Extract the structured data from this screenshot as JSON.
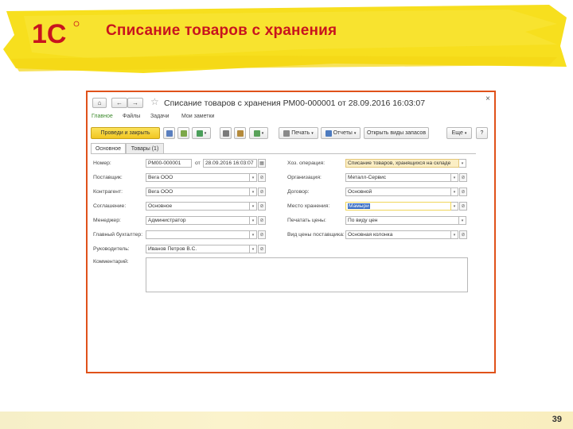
{
  "slide": {
    "title": "Списание товаров с хранения",
    "number": "39",
    "logo_text": "1С"
  },
  "window": {
    "title": "Списание товаров с хранения РМ00-000001 от 28.09.2016 16:03:07",
    "close_glyph": "×",
    "nav": {
      "home": "⌂",
      "back": "←",
      "forward": "→",
      "star": "☆"
    },
    "sections": [
      "Главное",
      "Файлы",
      "Задачи",
      "Мои заметки"
    ],
    "toolbar": {
      "post_and_close": "Проведи и закрыть",
      "print": "Печать",
      "reports": "Отчеты",
      "open_stock": "Открыть виды запасов",
      "more": "Еще",
      "help": "?"
    },
    "tabs": [
      "Основное",
      "Товары (1)"
    ]
  },
  "form": {
    "left": {
      "number_label": "Номер:",
      "number_value": "РМ00-000001",
      "date_sep": "от",
      "date_value": "28.09.2016 16:03:07",
      "supplier_label": "Поставщик:",
      "supplier_value": "Вега ООО",
      "counterparty_label": "Контрагент:",
      "counterparty_value": "Вега ООО",
      "agreement_label": "Соглашение:",
      "agreement_value": "Основное",
      "manager_label": "Менеджер:",
      "manager_value": "Администратор",
      "chief_acc_label": "Главный бухгалтер:",
      "chief_acc_value": "",
      "head_label": "Руководитель:",
      "head_value": "Иванов Петров В.С.",
      "comment_label": "Комментарий:"
    },
    "right": {
      "operation_label": "Хоз. операция:",
      "operation_value": "Списание товаров, хранящихся на складе",
      "org_label": "Организация:",
      "org_value": "Металл-Сервис",
      "contract_label": "Договор:",
      "contract_value": "Основной",
      "storage_label": "Место хранения:",
      "storage_value": "Мамыри",
      "print_prices_label": "Печатать цены:",
      "print_prices_value": "По виду цен",
      "price_type_label": "Вид цены поставщика:",
      "price_type_value": "Основная колонка"
    }
  },
  "colors": {
    "title_red": "#c8141e",
    "banner_yellow": "#f7df1e",
    "window_border": "#e0521a",
    "post_button": "#f1c621",
    "section_active": "#3c8a2c",
    "highlight_field": "#fbeec4"
  }
}
